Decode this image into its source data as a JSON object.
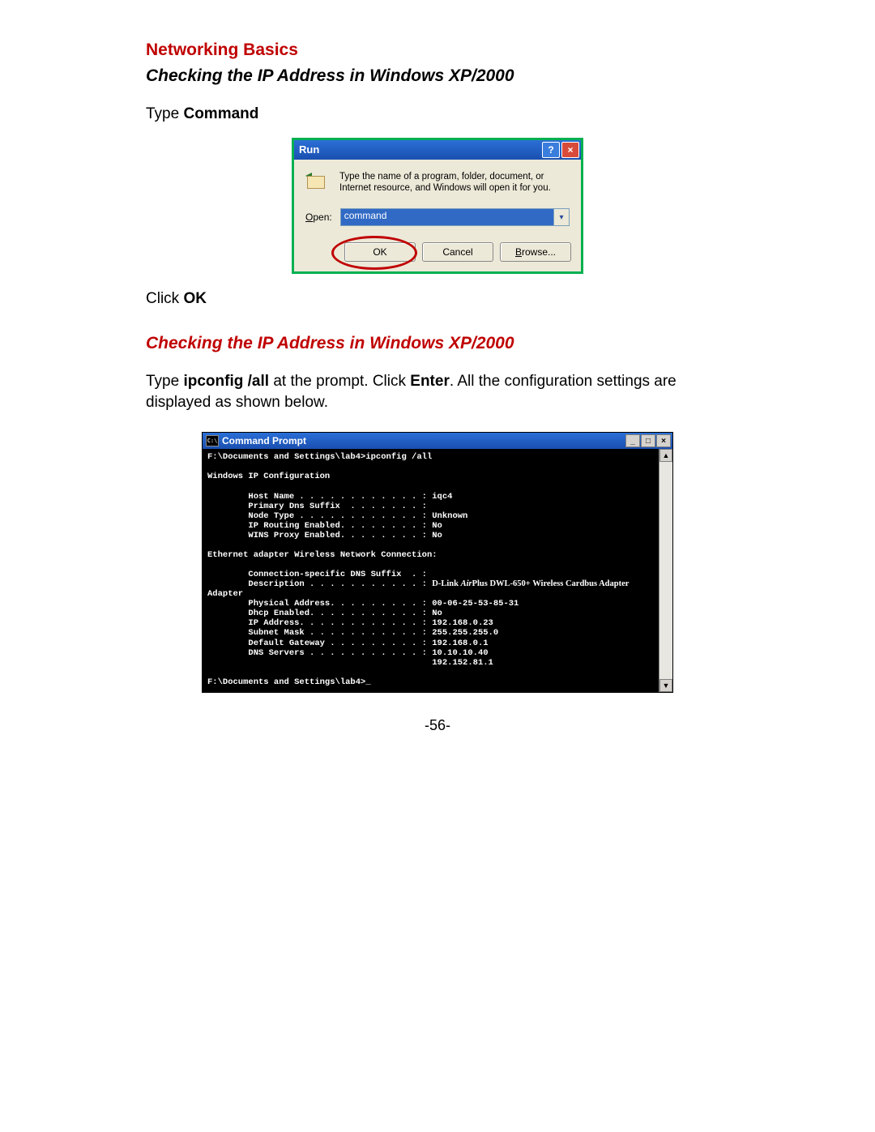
{
  "headings": {
    "section": "Networking Basics",
    "sub1": "Checking the IP Address in Windows XP/2000",
    "sub2": "Checking the IP Address in Windows XP/2000"
  },
  "instr": {
    "type_pre": "Type ",
    "type_bold": "Command",
    "click_pre": "Click ",
    "click_bold": "OK",
    "para2_a": "Type ",
    "para2_b": "ipconfig /all",
    "para2_c": " at the prompt.    Click ",
    "para2_d": "Enter",
    "para2_e": ".    All the configuration settings are displayed as shown below."
  },
  "run": {
    "title": "Run",
    "help": "?",
    "close": "×",
    "desc": "Type the name of a program, folder, document, or Internet resource, and Windows will open it for you.",
    "open_letter": "O",
    "open_rest": "pen:",
    "value": "command",
    "dropdown": "▾",
    "ok": "OK",
    "cancel": "Cancel",
    "browse_letter": "B",
    "browse_rest": "rowse..."
  },
  "cmd": {
    "title": "Command Prompt",
    "icon_text": "C:\\",
    "min": "_",
    "max": "□",
    "close": "×",
    "scroll_up": "▲",
    "scroll_down": "▼",
    "line_cmd": "F:\\Documents and Settings\\lab4>ipconfig /all",
    "line_header": "Windows IP Configuration",
    "cfg_host": "        Host Name . . . . . . . . . . . . : iqc4",
    "cfg_prim": "        Primary Dns Suffix  . . . . . . . :",
    "cfg_node": "        Node Type . . . . . . . . . . . . : Unknown",
    "cfg_rout": "        IP Routing Enabled. . . . . . . . : No",
    "cfg_wins": "        WINS Proxy Enabled. . . . . . . . : No",
    "line_adapter": "Ethernet adapter Wireless Network Connection:",
    "ad_dns": "        Connection-specific DNS Suffix  . :",
    "ad_desc_a": "        Description . . . . . . . . . . . : ",
    "ad_desc_b1": "D-Link ",
    "ad_desc_b2": "Air",
    "ad_desc_b3": "Plus DWL-650+ Wireless Cardbus Adapter",
    "ad_tail": "Adapter",
    "ad_phys": "        Physical Address. . . . . . . . . : 00-06-25-53-85-31",
    "ad_dhcp": "        Dhcp Enabled. . . . . . . . . . . : No",
    "ad_ip": "        IP Address. . . . . . . . . . . . : 192.168.0.23",
    "ad_mask": "        Subnet Mask . . . . . . . . . . . : 255.255.255.0",
    "ad_gw": "        Default Gateway . . . . . . . . . : 192.168.0.1",
    "ad_dns1": "        DNS Servers . . . . . . . . . . . : 10.10.10.40",
    "ad_dns2": "                                            192.152.81.1",
    "line_prompt2": "F:\\Documents and Settings\\lab4>_"
  },
  "page_number": "-56-"
}
